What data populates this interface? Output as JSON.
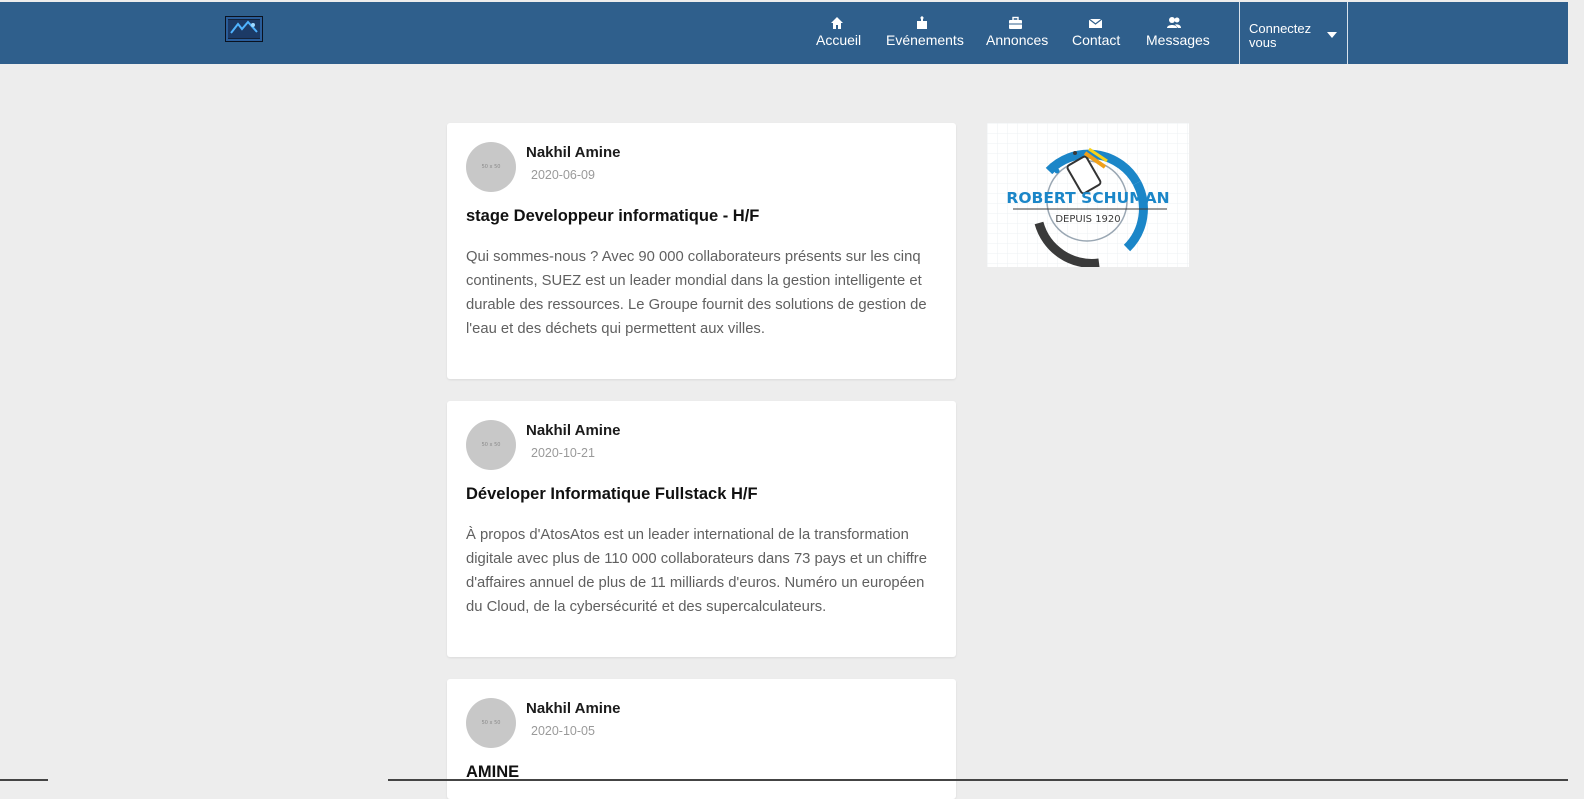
{
  "nav": {
    "items": [
      {
        "label": "Accueil",
        "icon": "home-icon"
      },
      {
        "label": "Evénements",
        "icon": "puzzle-icon"
      },
      {
        "label": "Annonces",
        "icon": "briefcase-icon"
      },
      {
        "label": "Contact",
        "icon": "envelope-icon"
      },
      {
        "label": "Messages",
        "icon": "users-icon"
      }
    ],
    "connect_label": "Connectez vous",
    "colors": {
      "bar": "#2f5f8c",
      "text": "#ffffff"
    }
  },
  "posts": [
    {
      "avatar_text": "50 x 50",
      "author": "Nakhil Amine",
      "date": "2020-06-09",
      "title": "stage Developpeur informatique - H/F",
      "description": "Qui sommes-nous ? Avec 90 000 collaborateurs présents sur les cinq continents, SUEZ est un leader mondial dans la gestion intelligente et durable des ressources. Le Groupe fournit des solutions de gestion de l'eau et des déchets qui permettent aux villes."
    },
    {
      "avatar_text": "50 x 50",
      "author": "Nakhil Amine",
      "date": "2020-10-21",
      "title": "Déveloper Informatique Fullstack H/F",
      "description": "À propos d'AtosAtos est un leader international de la transformation digitale avec plus de 110 000 collaborateurs dans 73 pays et un chiffre d'affaires annuel de plus de 11 milliards d'euros. Numéro un européen du Cloud, de la cybersécurité et des supercalculateurs."
    },
    {
      "avatar_text": "50 x 50",
      "author": "Nakhil Amine",
      "date": "2020-10-05",
      "title": "AMINE",
      "description": ""
    }
  ],
  "sidebar_logo": {
    "name": "ROBERT SCHUMAN",
    "tagline": "DEPUIS 1920",
    "colors": {
      "blue": "#1b86c8",
      "dark": "#3a3a3a"
    }
  }
}
